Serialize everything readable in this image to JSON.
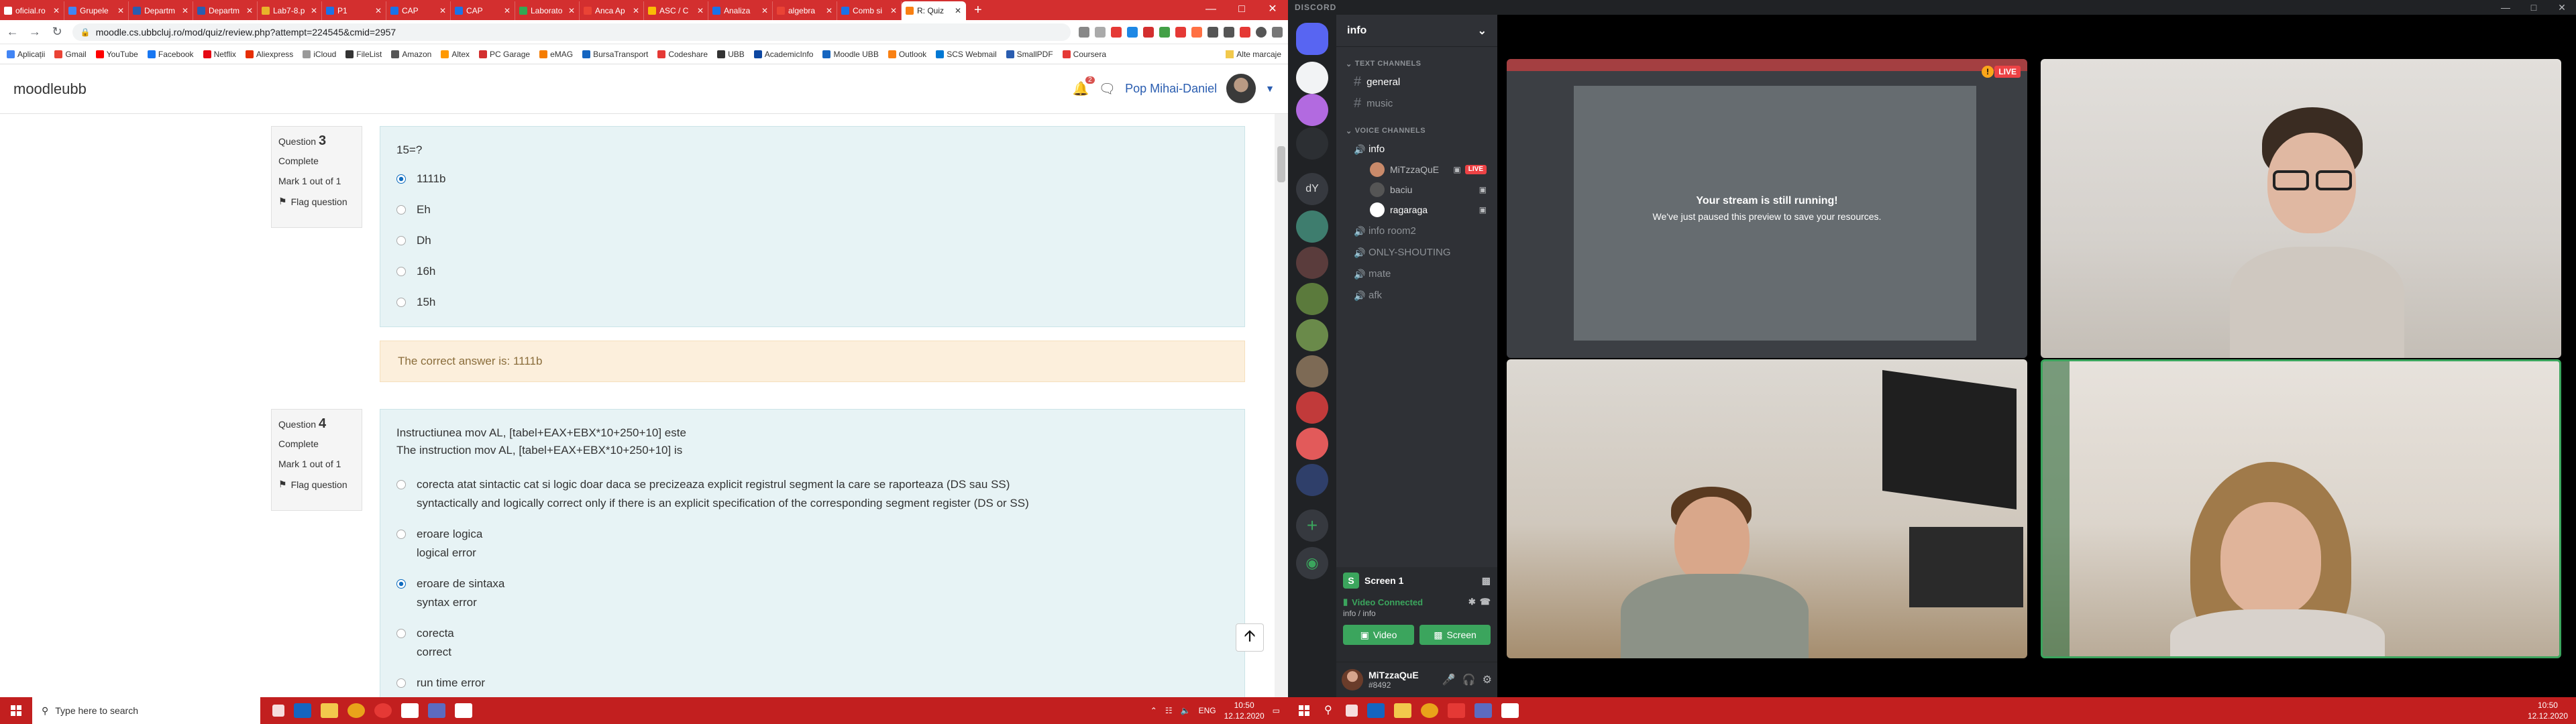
{
  "browser": {
    "tabs": [
      {
        "label": "oficial.ro",
        "fav": "#fff"
      },
      {
        "label": "Grupele",
        "fav": "#4285f4"
      },
      {
        "label": "Departm",
        "fav": "#2a5db0"
      },
      {
        "label": "Departm",
        "fav": "#2a5db0"
      },
      {
        "label": "Lab7-8.p",
        "fav": "#e8b32a"
      },
      {
        "label": "P1",
        "fav": "#1a73e8"
      },
      {
        "label": "CAP",
        "fav": "#1a73e8"
      },
      {
        "label": "CAP",
        "fav": "#1a73e8"
      },
      {
        "label": "Laborato",
        "fav": "#34a853"
      },
      {
        "label": "Anca Ap",
        "fav": "#ea4335"
      },
      {
        "label": "ASC / C",
        "fav": "#fbbc05"
      },
      {
        "label": "Analiza",
        "fav": "#1a73e8"
      },
      {
        "label": "algebra",
        "fav": "#ea4335"
      },
      {
        "label": "Comb si",
        "fav": "#1a73e8"
      },
      {
        "label": "R: Quiz",
        "fav": "#f98012"
      }
    ],
    "new_tab": "+",
    "url": "moodle.cs.ubbcluj.ro/mod/quiz/review.php?attempt=224545&cmid=2957",
    "bookmarks": [
      "Aplicații",
      "Gmail",
      "YouTube",
      "Facebook",
      "Netflix",
      "Aliexpress",
      "iCloud",
      "FileList",
      "Amazon",
      "Altex",
      "PC Garage",
      "eMAG",
      "BursaTransport",
      "Codeshare",
      "UBB",
      "AcademicInfo",
      "Moodle UBB",
      "Outlook",
      "SCS Webmail",
      "SmallPDF",
      "Coursera"
    ],
    "bookmark_other": "Alte marcaje"
  },
  "moodle": {
    "brand": "moodleubb",
    "notif_count": "2",
    "user_name": "Pop Mihai-Daniel",
    "questions": [
      {
        "number_prefix": "Question",
        "number": "3",
        "status": "Complete",
        "mark": "Mark 1 out of 1",
        "flag": "Flag question",
        "text": [
          "15=?"
        ],
        "options": [
          {
            "lines": [
              "1111b"
            ],
            "selected": true
          },
          {
            "lines": [
              "Eh"
            ],
            "selected": false
          },
          {
            "lines": [
              "Dh"
            ],
            "selected": false
          },
          {
            "lines": [
              "16h"
            ],
            "selected": false
          },
          {
            "lines": [
              "15h"
            ],
            "selected": false
          }
        ],
        "feedback": "The correct answer is: 1111b"
      },
      {
        "number_prefix": "Question",
        "number": "4",
        "status": "Complete",
        "mark": "Mark 1 out of 1",
        "flag": "Flag question",
        "text": [
          "Instructiunea mov AL, [tabel+EAX+EBX*10+250+10] este",
          "The instruction mov AL, [tabel+EAX+EBX*10+250+10] is"
        ],
        "options": [
          {
            "lines": [
              "corecta atat sintactic cat si logic doar daca se precizeaza explicit registrul segment la care se raporteaza (DS sau SS)",
              "syntactically and logically correct only if there is an explicit specification of the corresponding segment register (DS or SS)"
            ],
            "selected": false
          },
          {
            "lines": [
              "eroare logica",
              "logical error"
            ],
            "selected": false
          },
          {
            "lines": [
              "eroare de sintaxa",
              "syntax error"
            ],
            "selected": true
          },
          {
            "lines": [
              "corecta",
              "correct"
            ],
            "selected": false
          },
          {
            "lines": [
              "run time error"
            ],
            "selected": false
          }
        ]
      }
    ]
  },
  "taskbar_left": {
    "search_placeholder": "Type here to search",
    "lang": "ENG",
    "time": "10:50",
    "date": "12.12.2020"
  },
  "discord": {
    "app_title": "DISCORD",
    "server_name": "info",
    "guild_text_icon": "dY",
    "text_channels_label": "TEXT CHANNELS",
    "voice_channels_label": "VOICE CHANNELS",
    "text_channels": [
      "general",
      "music"
    ],
    "voice_channels": [
      {
        "name": "info",
        "users": [
          {
            "name": "MiTzzaQuE",
            "live": "LIVE"
          },
          {
            "name": "baciu",
            "live": ""
          },
          {
            "name": "ragaraga",
            "live": ""
          }
        ]
      },
      {
        "name": "info room2",
        "users": []
      },
      {
        "name": "ONLY-SHOUTING",
        "users": []
      },
      {
        "name": "mate",
        "users": []
      },
      {
        "name": "afk",
        "users": []
      }
    ],
    "screen_label": "Screen 1",
    "voice_status": "Video Connected",
    "voice_location": "info / info",
    "video_button": "Video",
    "screen_button": "Screen",
    "user_name": "MiTzzaQuE",
    "user_tag": "#8492",
    "stream_title": "Your stream is still running!",
    "stream_sub": "We've just paused this preview to save your resources.",
    "live_badge": "LIVE",
    "time": "10:50",
    "date": "12.12.2020"
  },
  "colors": {
    "taskbar": "#c21f1f",
    "moodle_question_bg": "#e7f3f5",
    "moodle_feedback_bg": "#fcefdc",
    "discord_green": "#3ba55d",
    "discord_red": "#ed4245"
  }
}
